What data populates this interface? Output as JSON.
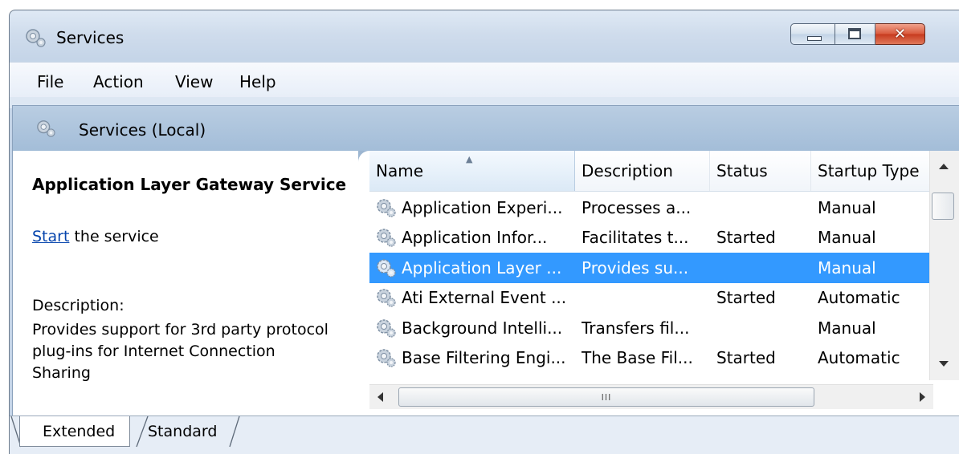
{
  "window": {
    "title": "Services",
    "minimize_icon": "minimize-icon",
    "maximize_icon": "maximize-icon",
    "close_icon": "close-icon",
    "close_glyph": "✕"
  },
  "menu": [
    "File",
    "Action",
    "View",
    "Help"
  ],
  "panel_header": {
    "title": "Services (Local)",
    "icon": "services-gear-icon"
  },
  "left_pane": {
    "service_title": "Application Layer Gateway Service",
    "start_link": "Start",
    "start_suffix": " the service",
    "description_label": "Description:",
    "description": "Provides support for 3rd party protocol plug-ins for Internet Connection Sharing"
  },
  "list": {
    "columns": [
      "Name",
      "Description",
      "Status",
      "Startup Type"
    ],
    "sort_glyph": "▲",
    "rows": [
      {
        "name": "Application Experi...",
        "description": "Processes a...",
        "status": "",
        "startup": "Manual",
        "selected": false
      },
      {
        "name": "Application Infor...",
        "description": "Facilitates t...",
        "status": "Started",
        "startup": "Manual",
        "selected": false
      },
      {
        "name": "Application Layer ...",
        "description": "Provides su...",
        "status": "",
        "startup": "Manual",
        "selected": true
      },
      {
        "name": "Ati External Event ...",
        "description": "",
        "status": "Started",
        "startup": "Automatic",
        "selected": false
      },
      {
        "name": "Background Intelli...",
        "description": "Transfers fil...",
        "status": "",
        "startup": "Manual",
        "selected": false
      },
      {
        "name": "Base Filtering Engi...",
        "description": "The Base Fil...",
        "status": "Started",
        "startup": "Automatic",
        "selected": false
      }
    ],
    "hscroll_grip": "III"
  },
  "tabs": [
    "Extended",
    "Standard"
  ],
  "colors": {
    "selection": "#3399ff",
    "link": "#0645ad",
    "header_band": "#a3bdd8",
    "close_button": "#c73a1e"
  }
}
